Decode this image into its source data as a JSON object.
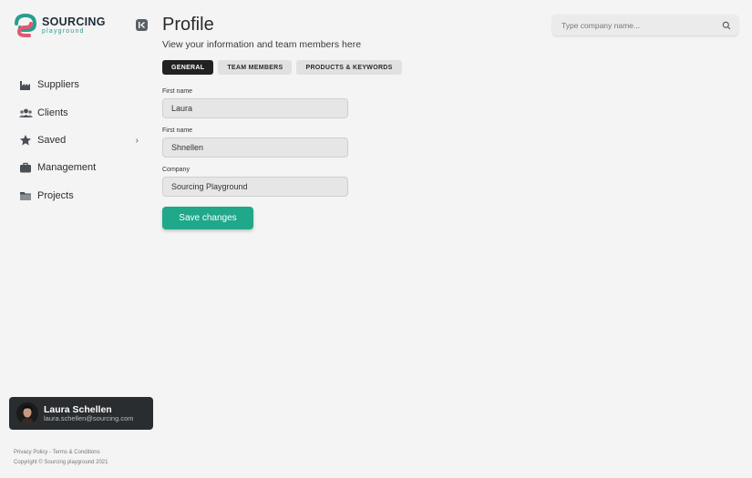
{
  "brand": {
    "title": "SOURCING",
    "subtitle": "playground"
  },
  "sidebar": {
    "items": [
      {
        "label": "Suppliers",
        "icon": "factory-icon"
      },
      {
        "label": "Clients",
        "icon": "people-icon"
      },
      {
        "label": "Saved",
        "icon": "star-icon",
        "has_submenu": true
      },
      {
        "label": "Management",
        "icon": "briefcase-icon"
      },
      {
        "label": "Projects",
        "icon": "folder-icon"
      }
    ]
  },
  "user": {
    "name": "Laura Schellen",
    "email": "laura.schellen@sourcing.com"
  },
  "footer": {
    "privacy": "Privacy Policy",
    "separator": " - ",
    "terms": "Terms & Conditions",
    "copyright": "Copyright © Sourcing playground 2021"
  },
  "page": {
    "title": "Profile",
    "subtitle": "View your information and team members here"
  },
  "tabs": [
    {
      "label": "GENERAL",
      "active": true
    },
    {
      "label": "TEAM MEMBERS",
      "active": false
    },
    {
      "label": "PRODUCTS & KEYWORDS",
      "active": false
    }
  ],
  "form": {
    "fields": [
      {
        "label": "First name",
        "value": "Laura"
      },
      {
        "label": "First name",
        "value": "Shnellen"
      },
      {
        "label": "Company",
        "value": "Sourcing Playground"
      }
    ],
    "save_label": "Save changes"
  },
  "search": {
    "placeholder": "Type company name..."
  },
  "colors": {
    "accent": "#1fa88a",
    "dark": "#222222",
    "background": "#f4f4f4"
  }
}
